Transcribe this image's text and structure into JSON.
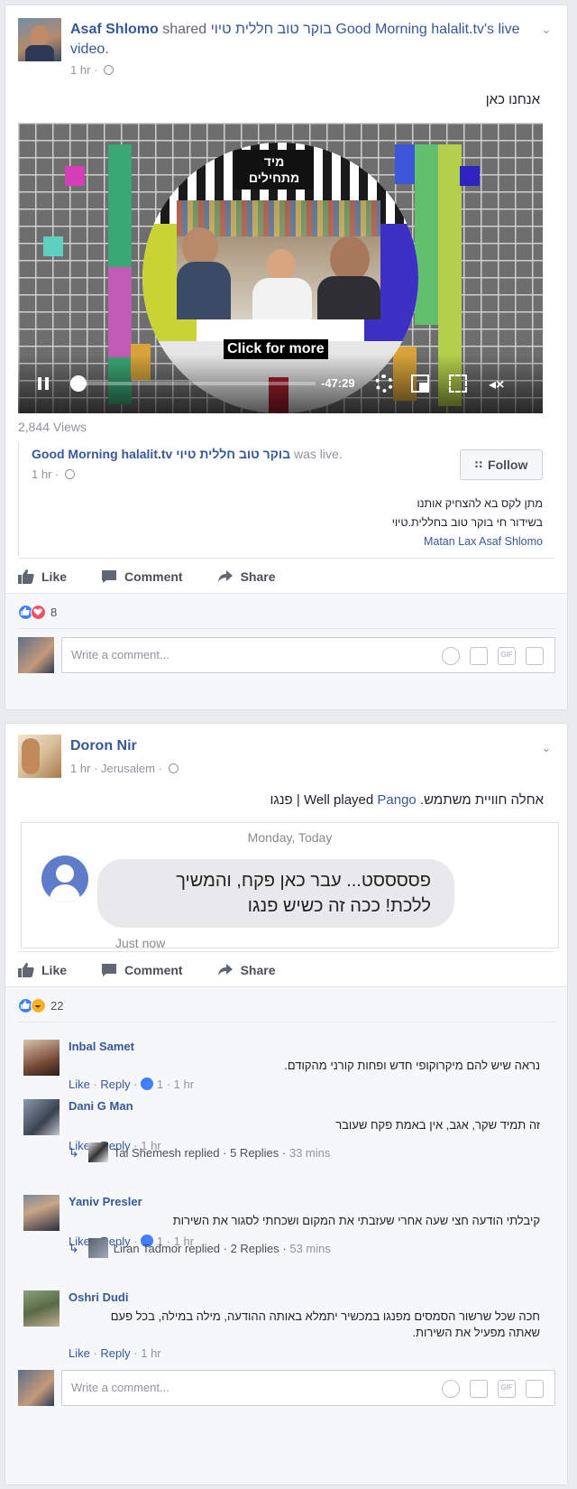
{
  "post1": {
    "author": "Asaf Shlomo",
    "shared_text": " shared ",
    "page_name": "בוקר טוב חללית טיוי Good Morning halalit.tv's",
    "shared_suffix": "live video.",
    "time": "1 hr",
    "text": "אנחנו כאן",
    "video": {
      "sign_line1": "מיד",
      "sign_line2": "מתחילים",
      "click_for_more": "Click for more",
      "time_remaining": "-47:29",
      "progress": 0.02
    },
    "views": "2,844 Views",
    "shared_page": "Good Morning halalit.tv בוקר טוב חללית טיוי",
    "shared_page_status": " was live.",
    "shared_time": "1 hr",
    "follow_label": "Follow",
    "desc_line1": "מתן לקס בא להצחיק אותנו",
    "desc_line2": "בשידור חי בוקר טוב בחללית.טיוי",
    "desc_line3": "Matan Lax Asaf Shlomo",
    "actions": {
      "like": "Like",
      "comment": "Comment",
      "share": "Share"
    },
    "reaction_count": "8",
    "comment_placeholder": "Write a comment..."
  },
  "post2": {
    "author": "Doron Nir",
    "time": "1 hr",
    "location": "Jerusalem",
    "text_part1": "אחלה חוויית משתמש.",
    "text_part2": "Well played",
    "text_link": "Pango",
    "text_part3": "| פנגו",
    "chat": {
      "date": "Monday, Today",
      "bubble_line1": "פססססט... עבר כאן פקח, והמשיך",
      "bubble_line2": "ללכת! ככה זה כשיש פנגו",
      "status": "Just now"
    },
    "actions": {
      "like": "Like",
      "comment": "Comment",
      "share": "Share"
    },
    "reaction_count": "22",
    "comments": [
      {
        "name": "Inbal Samet",
        "text": "נראה שיש להם מיקרוקופי חדש ופחות קורני מהקודם.",
        "like": "Like",
        "reply": "Reply",
        "likes": "1",
        "time": "1 hr"
      },
      {
        "name": "Dani G Man",
        "text": "זה תמיד שקר, אגב, אין באמת פקח שעובר",
        "like": "Like",
        "reply": "Reply",
        "time": "1 hr",
        "reply_summary": {
          "who": "Tal Shemesh replied",
          "count": "5 Replies",
          "time": "33 mins"
        }
      },
      {
        "name": "Yaniv Presler",
        "text": "קיבלתי הודעה חצי שעה אחרי שעזבתי את המקום ושכחתי לסגור את השירות",
        "like": "Like",
        "reply": "Reply",
        "likes": "1",
        "time": "1 hr",
        "reply_summary": {
          "who": "Liran Tadmor replied",
          "count": "2 Replies",
          "time": "53 mins"
        }
      },
      {
        "name": "Oshri Dudi",
        "text_line1": "חכה שכל שרשור הסמסים מפנגו במכשיר יתמלא באותה ההודעה, מילה במילה, בכל פעם",
        "text_line2": "שאתה מפעיל את השירות.",
        "like": "Like",
        "reply": "Reply",
        "time": "1 hr"
      }
    ],
    "comment_placeholder": "Write a comment..."
  },
  "colors": {
    "link": "#365899",
    "meta": "#90949c",
    "like_blue": "#4080ff",
    "love_red": "#f25268"
  }
}
